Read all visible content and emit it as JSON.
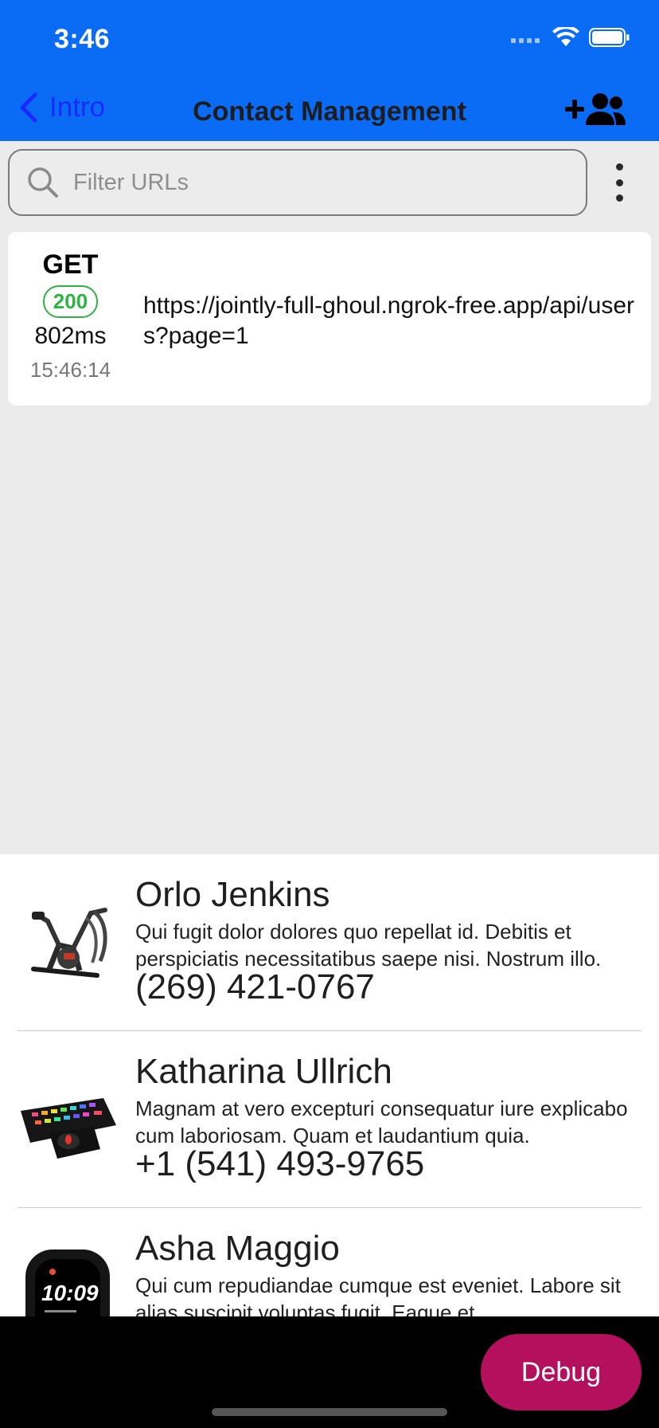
{
  "status_bar": {
    "time": "3:46"
  },
  "nav": {
    "back_label": "Intro",
    "title": "Contact Management",
    "action_icon": "person-add-icon"
  },
  "search": {
    "placeholder": "Filter URLs"
  },
  "request": {
    "method": "GET",
    "status": "200",
    "duration": "802ms",
    "timestamp": "15:46:14",
    "url": "https://jointly-full-ghoul.ngrok-free.app/api/users?page=1"
  },
  "contacts": [
    {
      "name": "Orlo Jenkins",
      "bio": "Qui fugit dolor dolores quo repellat id. Debitis et perspiciatis necessitatibus saepe nisi. Nostrum illo.",
      "phone": "(269) 421-0767",
      "image": "exercise-bike-image"
    },
    {
      "name": "Katharina Ullrich",
      "bio": "Magnam at vero excepturi consequatur iure explicabo cum laboriosam. Quam et laudantium quia.",
      "phone": "+1 (541) 493-9765",
      "image": "keyboard-image"
    },
    {
      "name": "Asha Maggio",
      "bio": "Qui cum repudiandae cumque est eveniet. Labore sit alias suscipit voluptas fugit. Eaque et.",
      "phone": "",
      "image": "smartwatch-image"
    }
  ],
  "debug": {
    "label": "Debug"
  },
  "colors": {
    "header_bg": "#0a6cf5",
    "back_link": "#1b2aff",
    "status_ok": "#2fb344",
    "debug_button": "#b5105e"
  }
}
